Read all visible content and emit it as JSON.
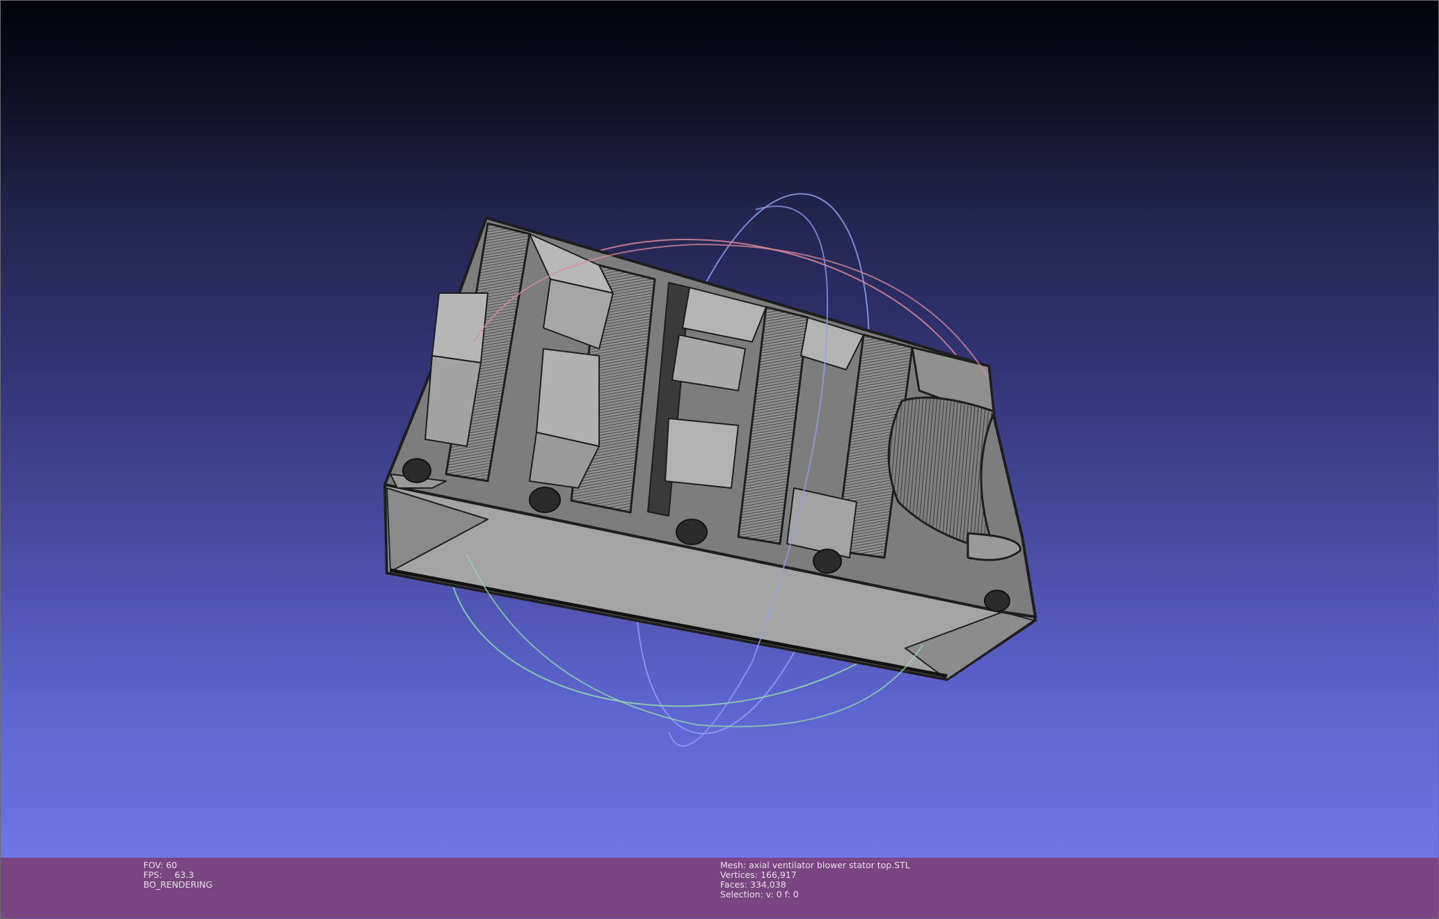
{
  "viewport": {
    "background_top": "#02030a",
    "background_bottom": "#7075e8",
    "mesh_color": "#9a9a9a",
    "trackball_colors": {
      "x_ring": "#e08a9e",
      "y_ring": "#8f9ff0",
      "z_ring": "#8fd9a8"
    }
  },
  "info_bar": {
    "background": "#7b4482",
    "fov_label": "FOV:",
    "fov_value": "60",
    "fps_label": "FPS:",
    "fps_value": "63.3",
    "render_mode": "BO_RENDERING",
    "mesh_line": "Mesh: axial ventilator blower stator top.STL",
    "vertices_line": "Vertices: 166,917",
    "faces_line": "Faces: 334,038",
    "selection_line": "Selection: v: 0 f: 0"
  }
}
